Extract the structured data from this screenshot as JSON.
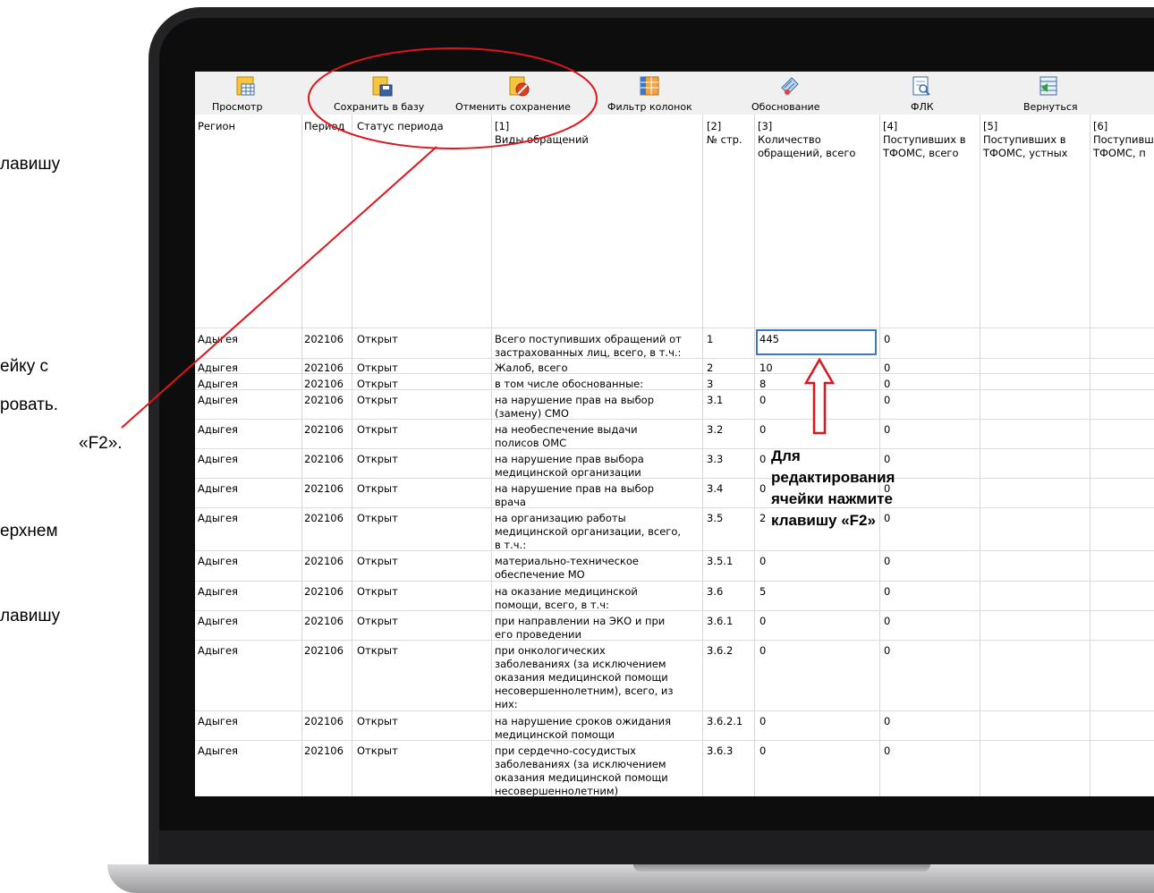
{
  "left_fragments": [
    "лавишу",
    "ейку с",
    "ровать.",
    "«F2».",
    "ерхнем",
    "лавишу"
  ],
  "toolbar": {
    "view": "Просмотр",
    "save_to_db": "Сохранить в базу",
    "cancel_save": "Отменить сохранение",
    "column_filter": "Фильтр колонок",
    "justification": "Обоснование",
    "flk": "ФЛК",
    "back": "Вернуться"
  },
  "columns": {
    "region": "Регион",
    "period": "Период",
    "status": "Статус периода",
    "c1_num": "[1]",
    "c1_name": "Виды обращений",
    "c2_num": "[2]",
    "c2_name": "№ стр.",
    "c3_num": "[3]",
    "c3_name_1": "Количество",
    "c3_name_2": "обращений, всего",
    "c4_num": "[4]",
    "c4_name_1": "Поступивших в",
    "c4_name_2": "ТФОМС, всего",
    "c5_num": "[5]",
    "c5_name_1": "Поступивших в",
    "c5_name_2": "ТФОМС, устных",
    "c6_num": "[6]",
    "c6_name_1": "Поступивш",
    "c6_name_2": "ТФОМС, п"
  },
  "rows": [
    {
      "region": "Адыгея",
      "period": "202106",
      "status": "Открыт",
      "kind": [
        "Всего поступивших обращений от",
        "застрахованных лиц, всего, в т.ч.:"
      ],
      "num": "1",
      "total": "445",
      "tfoms": "0"
    },
    {
      "region": "Адыгея",
      "period": "202106",
      "status": "Открыт",
      "kind": [
        "Жалоб, всего"
      ],
      "num": "2",
      "total": "10",
      "tfoms": "0"
    },
    {
      "region": "Адыгея",
      "period": "202106",
      "status": "Открыт",
      "kind": [
        "в том числе обоснованные:"
      ],
      "num": "3",
      "total": "8",
      "tfoms": "0"
    },
    {
      "region": "Адыгея",
      "period": "202106",
      "status": "Открыт",
      "kind": [
        "на нарушение прав на выбор",
        "(замену) СМО"
      ],
      "num": "3.1",
      "total": "0",
      "tfoms": "0"
    },
    {
      "region": "Адыгея",
      "period": "202106",
      "status": "Открыт",
      "kind": [
        "на необеспечение выдачи",
        "полисов ОМС"
      ],
      "num": "3.2",
      "total": "0",
      "tfoms": "0"
    },
    {
      "region": "Адыгея",
      "period": "202106",
      "status": "Открыт",
      "kind": [
        "на нарушение прав выбора",
        "медицинской организации"
      ],
      "num": "3.3",
      "total": "0",
      "tfoms": "0"
    },
    {
      "region": "Адыгея",
      "period": "202106",
      "status": "Открыт",
      "kind": [
        "на нарушение прав на выбор",
        "врача"
      ],
      "num": "3.4",
      "total": "0",
      "tfoms": "0"
    },
    {
      "region": "Адыгея",
      "period": "202106",
      "status": "Открыт",
      "kind": [
        "на организацию работы",
        "медицинской организации, всего,",
        "в т.ч.:"
      ],
      "num": "3.5",
      "total": "2",
      "tfoms": "0"
    },
    {
      "region": "Адыгея",
      "period": "202106",
      "status": "Открыт",
      "kind": [
        "материально-техническое",
        "обеспечение МО"
      ],
      "num": "3.5.1",
      "total": "0",
      "tfoms": "0"
    },
    {
      "region": "Адыгея",
      "period": "202106",
      "status": "Открыт",
      "kind": [
        "на оказание медицинской",
        "помощи, всего, в т.ч:"
      ],
      "num": "3.6",
      "total": "5",
      "tfoms": "0"
    },
    {
      "region": "Адыгея",
      "period": "202106",
      "status": "Открыт",
      "kind": [
        "при направлении на ЭКО и при",
        "его проведении"
      ],
      "num": "3.6.1",
      "total": "0",
      "tfoms": "0"
    },
    {
      "region": "Адыгея",
      "period": "202106",
      "status": "Открыт",
      "kind": [
        "при онкологических",
        "заболеваниях (за исключением",
        "оказания медицинской помощи",
        "несовершеннолетним), всего, из",
        "них:"
      ],
      "num": "3.6.2",
      "total": "0",
      "tfoms": "0"
    },
    {
      "region": "Адыгея",
      "period": "202106",
      "status": "Открыт",
      "kind": [
        "на нарушение сроков ожидания",
        "медицинской помощи"
      ],
      "num": "3.6.2.1",
      "total": "0",
      "tfoms": "0"
    },
    {
      "region": "Адыгея",
      "period": "202106",
      "status": "Открыт",
      "kind": [
        "при сердечно-сосудистых",
        "заболеваниях (за исключением",
        "оказания медицинской помощи",
        "несовершеннолетним)"
      ],
      "num": "3.6.3",
      "total": "0",
      "tfoms": "0"
    }
  ],
  "annotation": {
    "line1": "Для",
    "line2": "редактирования",
    "line3": "ячейки нажмите",
    "line4": "клавишу «F2»"
  },
  "colors": {
    "annotation_red": "#e0141c",
    "selection_blue": "#3a78c9"
  }
}
